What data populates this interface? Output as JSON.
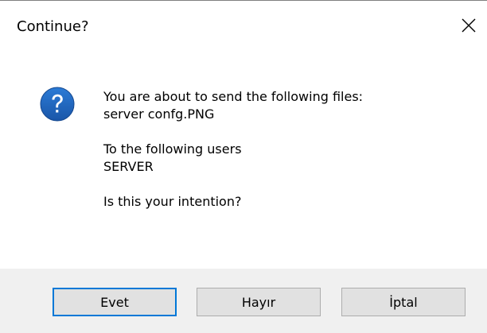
{
  "window": {
    "title": "Continue?",
    "close_icon": "close-icon"
  },
  "message": {
    "icon": "question-icon",
    "line1": "You are about to send the following files:",
    "line2": "server confg.PNG",
    "line3": "To the following users",
    "line4": "SERVER",
    "line5": "Is this your intention?"
  },
  "buttons": {
    "yes_label": "Evet",
    "no_label": "Hayır",
    "cancel_label": "İptal"
  },
  "colors": {
    "accent": "#0078d7",
    "icon_fill": "#1a5fb4",
    "footer_bg": "#f0f0f0",
    "button_bg": "#e1e1e1"
  }
}
